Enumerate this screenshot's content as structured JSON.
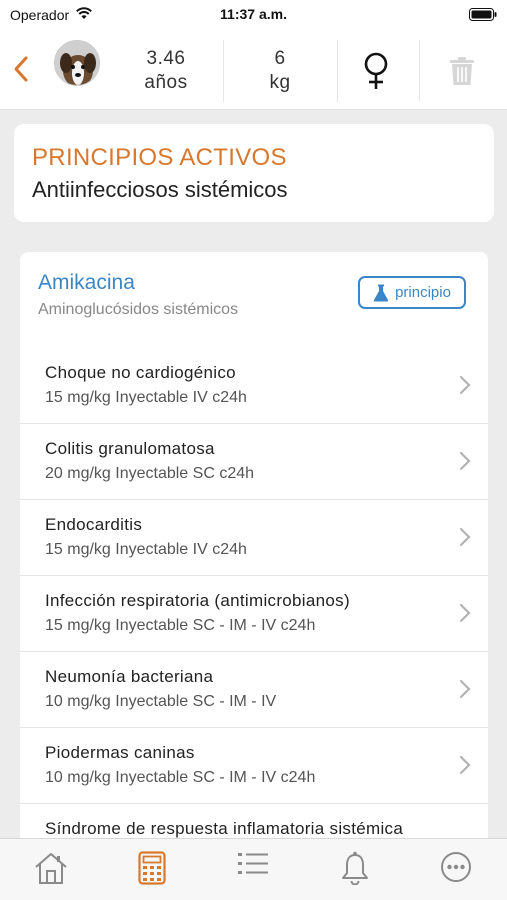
{
  "status_bar": {
    "carrier": "Operador",
    "time": "11:37 a.m."
  },
  "header": {
    "age_value": "3.46",
    "age_unit": "años",
    "weight_value": "6",
    "weight_unit": "kg",
    "sex_icon": "female-symbol-icon"
  },
  "section": {
    "title": "PRINCIPIOS ACTIVOS",
    "subtitle": "Antiinfecciosos sistémicos"
  },
  "drug": {
    "name": "Amikacina",
    "group": "Aminoglucósidos sistémicos",
    "button_label": "principio"
  },
  "indications": [
    {
      "title": "Choque no cardiogénico",
      "dose": "15 mg/kg Inyectable IV c24h"
    },
    {
      "title": "Colitis granulomatosa",
      "dose": "20 mg/kg Inyectable SC c24h"
    },
    {
      "title": "Endocarditis",
      "dose": "15 mg/kg Inyectable IV c24h"
    },
    {
      "title": "Infección respiratoria (antimicrobianos)",
      "dose": "15 mg/kg Inyectable SC - IM - IV c24h"
    },
    {
      "title": "Neumonía bacteriana",
      "dose": "10 mg/kg Inyectable SC - IM - IV"
    },
    {
      "title": "Piodermas caninas",
      "dose": "10 mg/kg Inyectable SC - IM - IV c24h"
    },
    {
      "title": "Síndrome de respuesta inflamatoria sistémica",
      "dose": ""
    }
  ],
  "colors": {
    "accent_orange": "#d8782e",
    "accent_blue": "#3a86c8",
    "background": "#ececec"
  },
  "tabs": [
    "home-icon",
    "calculator-icon",
    "list-icon",
    "bell-icon",
    "more-icon"
  ],
  "active_tab": "calculator-icon"
}
